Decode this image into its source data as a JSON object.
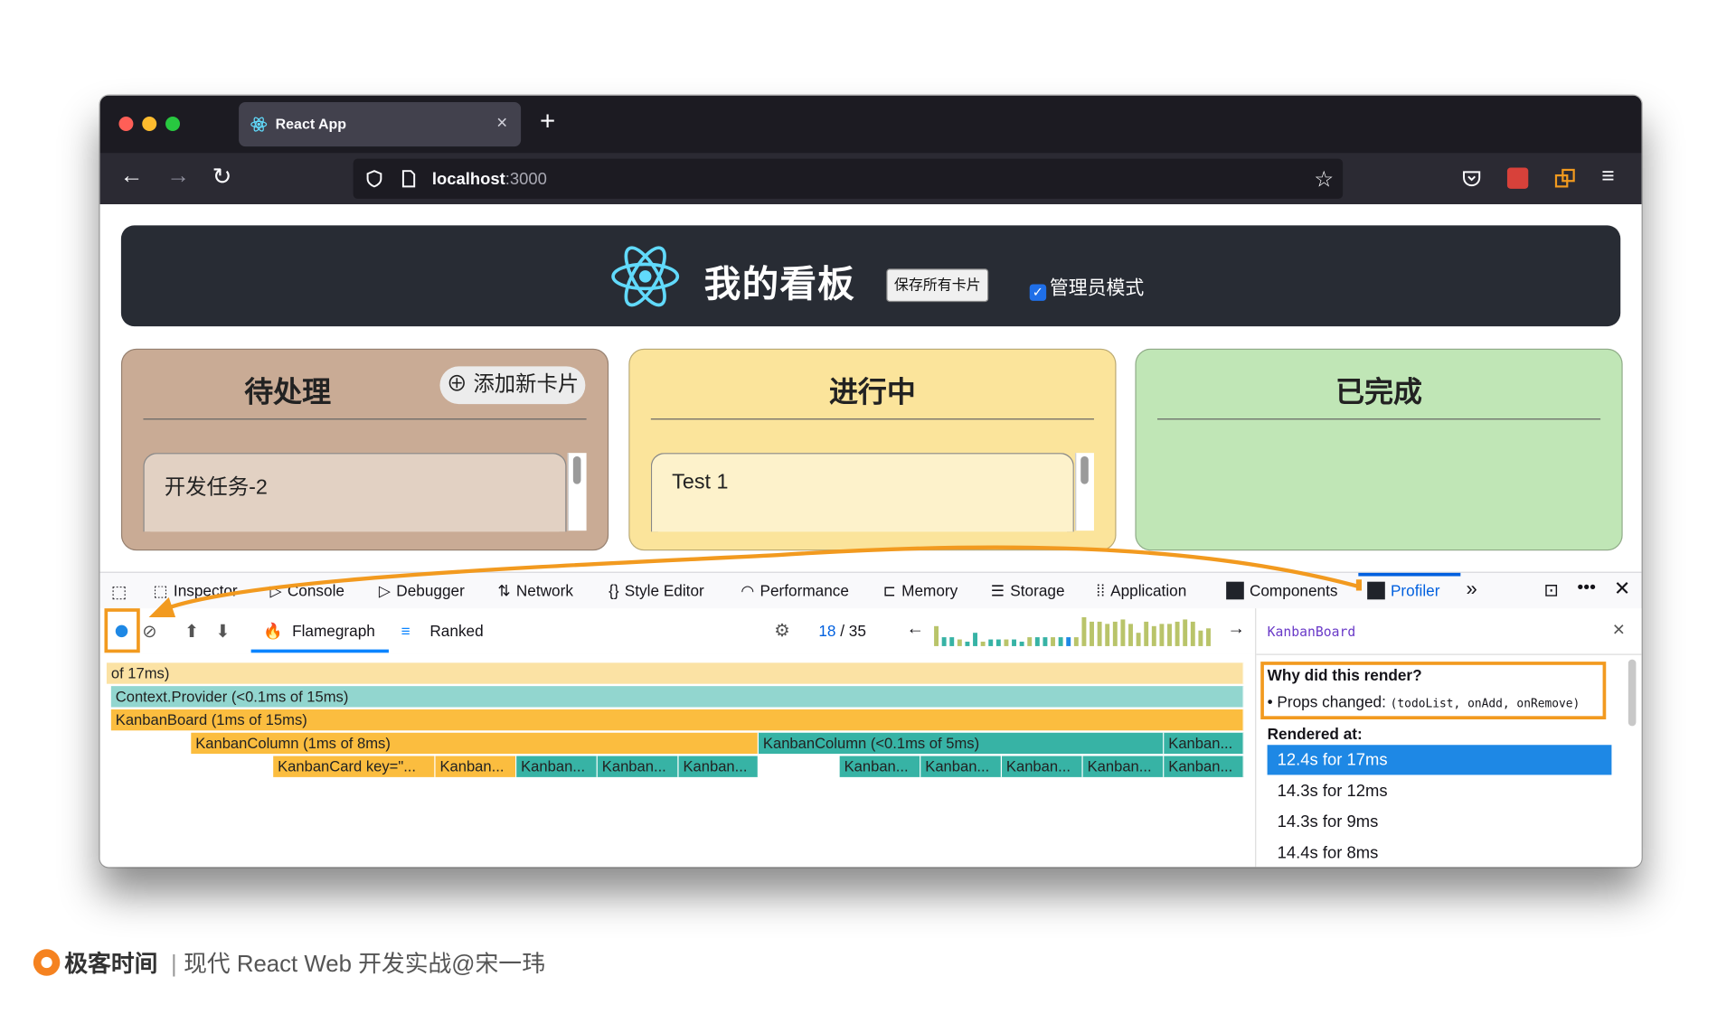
{
  "browser": {
    "tab_title": "React App",
    "tab_close": "×",
    "new_tab": "+",
    "url_host": "localhost",
    "url_port": ":3000"
  },
  "app": {
    "title": "我的看板",
    "save_button": "保存所有卡片",
    "admin_mode_label": "管理员模式",
    "columns": [
      {
        "title": "待处理",
        "add_button": "⊕ 添加新卡片",
        "card": "开发任务-2",
        "color": "#c9ab95"
      },
      {
        "title": "进行中",
        "card": "Test 1",
        "color": "#fbe49b"
      },
      {
        "title": "已完成",
        "color": "#c0e6b6"
      }
    ]
  },
  "devtools": {
    "tabs": [
      "Inspector",
      "Console",
      "Debugger",
      "Network",
      "Style Editor",
      "Performance",
      "Memory",
      "Storage",
      "Application",
      "Components",
      "Profiler"
    ],
    "active_tab": "Profiler",
    "more_tabs": "»"
  },
  "profiler": {
    "tab_flamegraph": "Flamegraph",
    "tab_ranked": "Ranked",
    "commit_current": "18",
    "commit_sep": "/",
    "commit_total": "35",
    "prev": "←",
    "next": "→",
    "flame_rows": [
      [
        {
          "label": "of 17ms)",
          "color": "#fbe2a4"
        }
      ],
      [
        {
          "label": "Context.Provider (<0.1ms of 15ms)",
          "color": "#92d6cf"
        }
      ],
      [
        {
          "label": "KanbanBoard (1ms of 15ms)",
          "color": "#fbbd3f"
        }
      ],
      [
        {
          "label": "KanbanColumn (1ms of 8ms)",
          "color": "#fbbd3f"
        },
        {
          "label": "KanbanColumn (<0.1ms of 5ms)",
          "color": "#37b3a5"
        },
        {
          "label": "Kanban...",
          "color": "#37b3a5"
        }
      ],
      [
        {
          "label": "KanbanCard key=\"...",
          "color": "#fbbd3f"
        },
        {
          "label": "Kanban...",
          "color": "#fbbd3f"
        },
        {
          "label": "Kanban...",
          "color": "#37b3a5"
        },
        {
          "label": "Kanban...",
          "color": "#37b3a5"
        },
        {
          "label": "Kanban...",
          "color": "#37b3a5"
        },
        {
          "label": "Kanban...",
          "color": "#37b3a5"
        },
        {
          "label": "Kanban...",
          "color": "#37b3a5"
        },
        {
          "label": "Kanban...",
          "color": "#37b3a5"
        },
        {
          "label": "Kanban...",
          "color": "#37b3a5"
        },
        {
          "label": "Kanban...",
          "color": "#37b3a5"
        }
      ]
    ]
  },
  "sidebar": {
    "component": "KanbanBoard",
    "close": "×",
    "why_title": "Why did this render?",
    "props_changed_label": "• Props changed:",
    "props_changed_list": "(todoList, onAdd, onRemove)",
    "rendered_at_title": "Rendered at:",
    "rendered_at": [
      "12.4s for 17ms",
      "14.3s for 12ms",
      "14.3s for 9ms",
      "14.4s for 8ms"
    ]
  },
  "footer": {
    "brand": "极客时间",
    "separator": "|",
    "course": "现代 React Web 开发实战@宋一玮"
  },
  "colors": {
    "accent": "#0060df",
    "highlight": "#f29a1f",
    "header_bg": "#282c34"
  }
}
